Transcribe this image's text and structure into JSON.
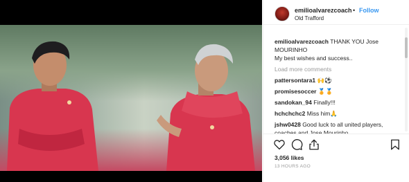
{
  "post": {
    "username": "emilioalvarezcoach",
    "separator": "•",
    "follow_label": "Follow",
    "location": "Old Trafford",
    "caption_user": "emilioalvarezcoach",
    "caption_text_1": "THANK YOU Jose MOURINHO",
    "caption_text_2": "My best wishes and success..",
    "load_more_label": "Load more comments",
    "likes": "3,056 likes",
    "time": "13 HOURS AGO"
  },
  "comments": [
    {
      "user": "pattersontara1",
      "text": "🙌⚽"
    },
    {
      "user": "promisesoccer",
      "text": "🏅🏅"
    },
    {
      "user": "sandokan_94",
      "text": "Finally!!!"
    },
    {
      "user": "hchchchc2",
      "text": "Miss him🙏"
    },
    {
      "user": "jshw0428",
      "text": "Good luck to all united players, coaches and Jose Mourinho."
    }
  ],
  "icons": {
    "like": "heart-icon",
    "comment": "comment-icon",
    "share": "share-icon",
    "save": "bookmark-icon"
  },
  "colors": {
    "follow": "#3897f0",
    "muted": "#999999",
    "text": "#262626",
    "kit_red": "#d8364f"
  }
}
